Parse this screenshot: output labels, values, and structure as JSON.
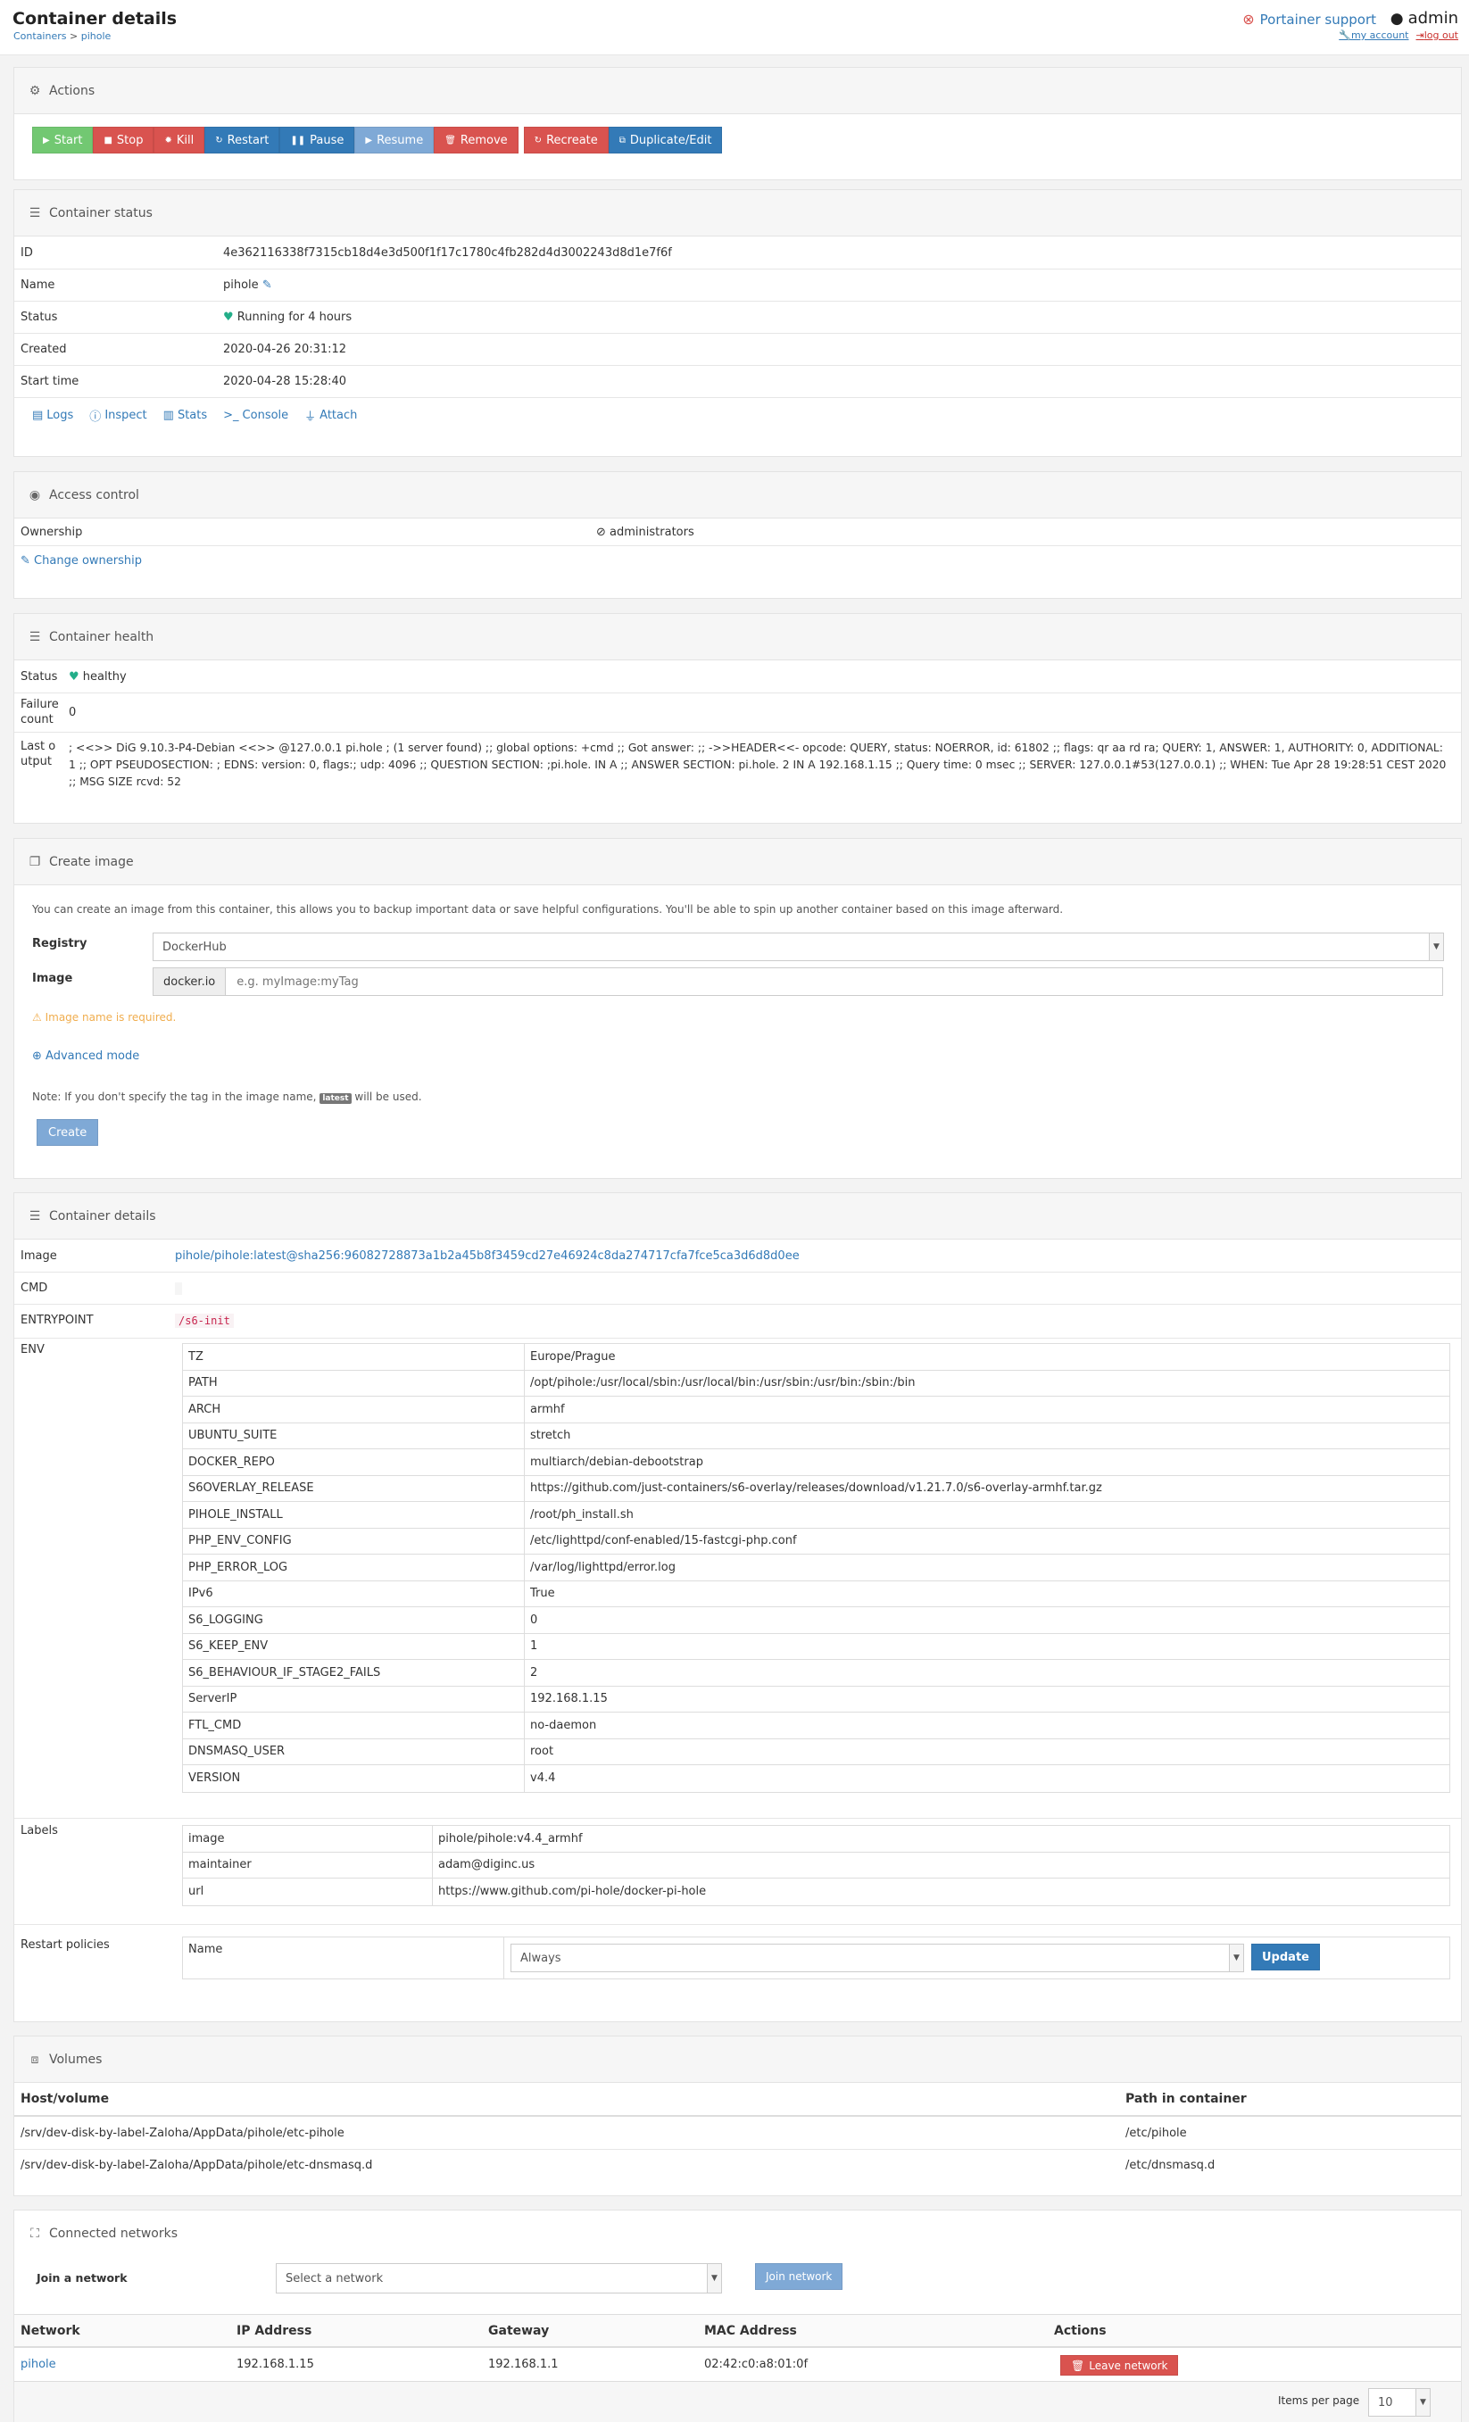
{
  "header": {
    "title": "Container details",
    "breadcrumb_link": "Containers",
    "breadcrumb_sep": " > ",
    "breadcrumb_current": "pihole",
    "support": "Portainer support",
    "user": "admin",
    "my_account": "my account",
    "logout": "log out"
  },
  "actions": {
    "title": "Actions",
    "buttons": [
      {
        "label": "Start",
        "icon": "▶",
        "color": "g"
      },
      {
        "label": "Stop",
        "icon": "■",
        "color": "r"
      },
      {
        "label": "Kill",
        "icon": "✹",
        "color": "r"
      },
      {
        "label": "Restart",
        "icon": "↻",
        "color": "b"
      },
      {
        "label": "Pause",
        "icon": "❚❚",
        "color": "b"
      },
      {
        "label": "Resume",
        "icon": "▶",
        "color": "lb"
      },
      {
        "label": "Remove",
        "icon": "🗑",
        "color": "r"
      },
      {
        "label": "Recreate",
        "icon": "↻",
        "color": "r"
      },
      {
        "label": "Duplicate/Edit",
        "icon": "⧉",
        "color": "b"
      }
    ]
  },
  "status": {
    "title": "Container status",
    "id_label": "ID",
    "id": "4e362116338f7315cb18d4e3d500f1f17c1780c4fb282d4d3002243d8d1e7f6f",
    "name_label": "Name",
    "name": "pihole",
    "status_label": "Status",
    "status": "Running for 4 hours",
    "created_label": "Created",
    "created": "2020-04-26 20:31:12",
    "start_label": "Start time",
    "start": "2020-04-28 15:28:40",
    "links": [
      "Logs",
      "Inspect",
      "Stats",
      "Console",
      "Attach"
    ]
  },
  "access": {
    "title": "Access control",
    "ownership_label": "Ownership",
    "ownership": "administrators",
    "change": "Change ownership"
  },
  "health": {
    "title": "Container health",
    "status_label": "Status",
    "status": "healthy",
    "failure_label": "Failure count",
    "failure": "0",
    "last_label": "Last output",
    "last": "; <<>> DiG 9.10.3-P4-Debian <<>> @127.0.0.1 pi.hole ; (1 server found) ;; global options: +cmd ;; Got answer: ;; ->>HEADER<<- opcode: QUERY, status: NOERROR, id: 61802 ;; flags: qr aa rd ra; QUERY: 1, ANSWER: 1, AUTHORITY: 0, ADDITIONAL: 1 ;; OPT PSEUDOSECTION: ; EDNS: version: 0, flags:; udp: 4096 ;; QUESTION SECTION: ;pi.hole. IN A ;; ANSWER SECTION: pi.hole. 2 IN A 192.168.1.15 ;; Query time: 0 msec ;; SERVER: 127.0.0.1#53(127.0.0.1) ;; WHEN: Tue Apr 28 19:28:51 CEST 2020 ;; MSG SIZE rcvd: 52"
  },
  "create_image": {
    "title": "Create image",
    "intro": "You can create an image from this container, this allows you to backup important data or save helpful configurations. You'll be able to spin up another container based on this image afterward.",
    "registry_label": "Registry",
    "registry": "DockerHub",
    "image_label": "Image",
    "prefix": "docker.io",
    "image_placeholder": "e.g. myImage:myTag",
    "warning": "Image name is required.",
    "advanced": "Advanced mode",
    "note_pre": "Note: If you don't specify the tag in the image name,",
    "note_badge": "latest",
    "note_post": "will be used.",
    "create": "Create"
  },
  "details": {
    "title": "Container details",
    "image_label": "Image",
    "image": "pihole/pihole:latest@sha256:96082728873a1b2a45b8f3459cd27e46924c8da274717cfa7fce5ca3d6d8d0ee",
    "cmd_label": "CMD",
    "entry_label": "ENTRYPOINT",
    "entry": "/s6-init",
    "env_label": "ENV",
    "env": [
      [
        "TZ",
        "Europe/Prague"
      ],
      [
        "PATH",
        "/opt/pihole:/usr/local/sbin:/usr/local/bin:/usr/sbin:/usr/bin:/sbin:/bin"
      ],
      [
        "ARCH",
        "armhf"
      ],
      [
        "UBUNTU_SUITE",
        "stretch"
      ],
      [
        "DOCKER_REPO",
        "multiarch/debian-debootstrap"
      ],
      [
        "S6OVERLAY_RELEASE",
        "https://github.com/just-containers/s6-overlay/releases/download/v1.21.7.0/s6-overlay-armhf.tar.gz"
      ],
      [
        "PIHOLE_INSTALL",
        "/root/ph_install.sh"
      ],
      [
        "PHP_ENV_CONFIG",
        "/etc/lighttpd/conf-enabled/15-fastcgi-php.conf"
      ],
      [
        "PHP_ERROR_LOG",
        "/var/log/lighttpd/error.log"
      ],
      [
        "IPv6",
        "True"
      ],
      [
        "S6_LOGGING",
        "0"
      ],
      [
        "S6_KEEP_ENV",
        "1"
      ],
      [
        "S6_BEHAVIOUR_IF_STAGE2_FAILS",
        "2"
      ],
      [
        "ServerIP",
        "192.168.1.15"
      ],
      [
        "FTL_CMD",
        "no-daemon"
      ],
      [
        "DNSMASQ_USER",
        "root"
      ],
      [
        "VERSION",
        "v4.4"
      ]
    ],
    "labels_label": "Labels",
    "labels": [
      [
        "image",
        "pihole/pihole:v4.4_armhf"
      ],
      [
        "maintainer",
        "adam@diginc.us"
      ],
      [
        "url",
        "https://www.github.com/pi-hole/docker-pi-hole"
      ]
    ],
    "restart_label": "Restart policies",
    "restart_name": "Name",
    "restart_value": "Always",
    "update": "Update"
  },
  "volumes": {
    "title": "Volumes",
    "col_host": "Host/volume",
    "col_path": "Path in container",
    "rows": [
      [
        "/srv/dev-disk-by-label-Zaloha/AppData/pihole/etc-pihole",
        "/etc/pihole"
      ],
      [
        "/srv/dev-disk-by-label-Zaloha/AppData/pihole/etc-dnsmasq.d",
        "/etc/dnsmasq.d"
      ]
    ]
  },
  "networks": {
    "title": "Connected networks",
    "join_label": "Join a network",
    "select_placeholder": "Select a network",
    "join_button": "Join network",
    "cols": [
      "Network",
      "IP Address",
      "Gateway",
      "MAC Address",
      "Actions"
    ],
    "row": {
      "network": "pihole",
      "ip": "192.168.1.15",
      "gateway": "192.168.1.1",
      "mac": "02:42:c0:a8:01:0f",
      "leave": "Leave network"
    },
    "items_per_page_label": "Items per page",
    "items_per_page": "10"
  }
}
